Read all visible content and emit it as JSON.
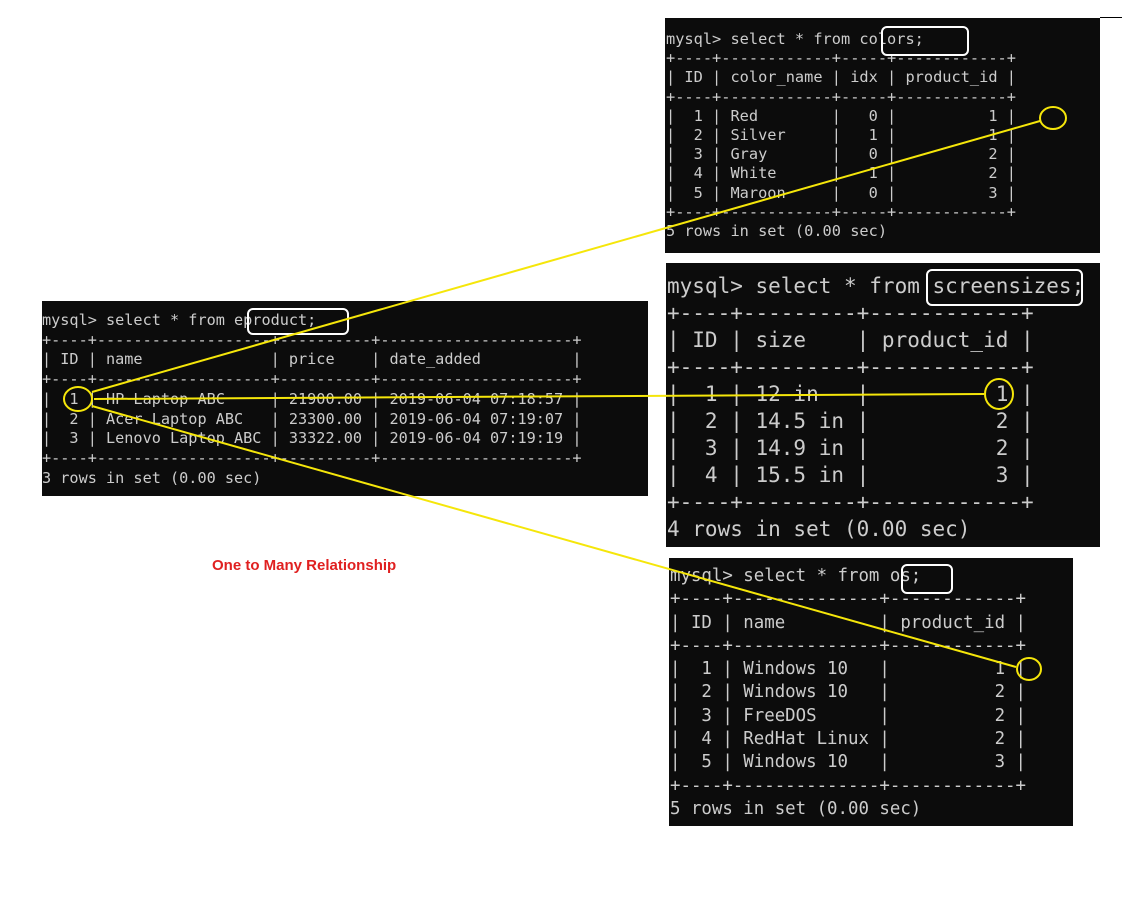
{
  "colors": {
    "command": "mysql> select * from colors;",
    "lines": [
      "+----+------------+-----+------------+",
      "| ID | color_name | idx | product_id |",
      "+----+------------+-----+------------+",
      "|  1 | Red        |   0 |          1 |",
      "|  2 | Silver     |   1 |          1 |",
      "|  3 | Gray       |   0 |          2 |",
      "|  4 | White      |   1 |          2 |",
      "|  5 | Maroon     |   0 |          3 |",
      "+----+------------+-----+------------+",
      "5 rows in set (0.00 sec)"
    ]
  },
  "screensizes": {
    "command": "mysql> select * from screensizes;",
    "lines": [
      "+----+---------+------------+",
      "| ID | size    | product_id |",
      "+----+---------+------------+",
      "|  1 | 12 in   |          1 |",
      "|  2 | 14.5 in |          2 |",
      "|  3 | 14.9 in |          2 |",
      "|  4 | 15.5 in |          3 |",
      "+----+---------+------------+",
      "4 rows in set (0.00 sec)"
    ]
  },
  "eproduct": {
    "command": "mysql> select * from eproduct;",
    "lines": [
      "+----+-------------------+----------+---------------------+",
      "| ID | name              | price    | date_added          |",
      "+----+-------------------+----------+---------------------+",
      "|  1 | HP Laptop ABC     | 21900.00 | 2019-06-04 07:18:57 |",
      "|  2 | Acer Laptop ABC   | 23300.00 | 2019-06-04 07:19:07 |",
      "|  3 | Lenovo Laptop ABC | 33322.00 | 2019-06-04 07:19:19 |",
      "+----+-------------------+----------+---------------------+",
      "3 rows in set (0.00 sec)"
    ]
  },
  "os": {
    "command": "mysql> select * from os;",
    "lines": [
      "+----+--------------+------------+",
      "| ID | name         | product_id |",
      "+----+--------------+------------+",
      "|  1 | Windows 10   |          1 |",
      "|  2 | Windows 10   |          2 |",
      "|  3 | FreeDOS      |          2 |",
      "|  4 | RedHat Linux |          2 |",
      "|  5 | Windows 10   |          3 |",
      "+----+--------------+------------+",
      "5 rows in set (0.00 sec)"
    ]
  },
  "caption": "One to Many Relationship",
  "colors_style": {
    "highlight": "#f5e60a",
    "terminal_bg": "#0c0c0c",
    "terminal_text": "#cccccc",
    "caption": "#e02020"
  }
}
